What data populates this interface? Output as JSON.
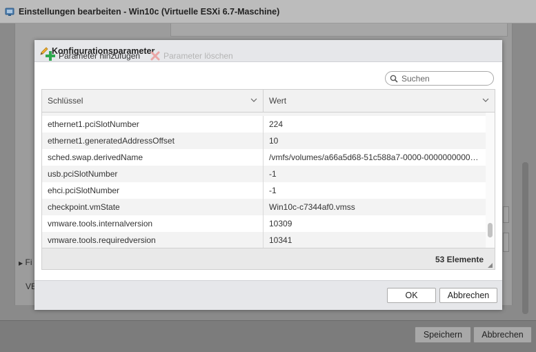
{
  "outer": {
    "title": "Einstellungen bearbeiten - Win10c (Virtuelle ESXi 6.7-Maschine)",
    "section_label_1": "Fi",
    "section_label_2": "VE",
    "save_label": "Speichern",
    "cancel_label": "Abbrechen"
  },
  "dialog": {
    "title": "Konfigurationsparameter",
    "add_label": "Parameter hinzufügen",
    "delete_label": "Parameter löschen",
    "search_placeholder": "Suchen",
    "columns": {
      "key": "Schlüssel",
      "value": "Wert"
    },
    "rows": [
      {
        "key": "ethernet1.pciSlotNumber",
        "value": "224"
      },
      {
        "key": "ethernet1.generatedAddressOffset",
        "value": "10"
      },
      {
        "key": "sched.swap.derivedName",
        "value": "/vmfs/volumes/a66a5d68-51c588a7-0000-00000000000..."
      },
      {
        "key": "usb.pciSlotNumber",
        "value": "-1"
      },
      {
        "key": "ehci.pciSlotNumber",
        "value": "-1"
      },
      {
        "key": "checkpoint.vmState",
        "value": "Win10c-c7344af0.vmss"
      },
      {
        "key": "vmware.tools.internalversion",
        "value": "10309"
      },
      {
        "key": "vmware.tools.requiredversion",
        "value": "10341"
      }
    ],
    "count_label": "53 Elemente",
    "ok_label": "OK",
    "cancel_label": "Abbrechen"
  },
  "colors": {
    "accent_green": "#2fa84f",
    "delete_red": "#e8a0a0",
    "overlay": "#6b6b6b"
  }
}
